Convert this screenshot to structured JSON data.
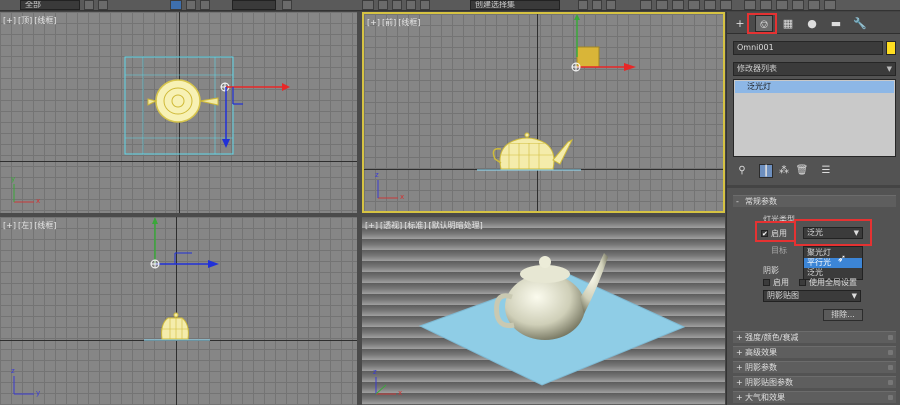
{
  "toolbar": {
    "selection_filter": "全部",
    "named_set": "创建选择集"
  },
  "viewports": {
    "top": {
      "label": [
        "[+]",
        "[顶]",
        "[线框]"
      ]
    },
    "front": {
      "label": [
        "[+]",
        "[前]",
        "[线框]"
      ]
    },
    "left": {
      "label": [
        "[+]",
        "[左]",
        "[线框]"
      ]
    },
    "perspective": {
      "label": [
        "[+]",
        "[透视]",
        "[标准]",
        "[默认明暗处理]"
      ]
    },
    "axis": {
      "x": "x",
      "y": "y",
      "z": "z"
    }
  },
  "panel": {
    "tabs": [
      "+",
      "⎊",
      "▦",
      "●",
      "▬",
      "🔧"
    ],
    "object_name": "Omni001",
    "object_color": "#ffde21",
    "modifier_list": "修改器列表",
    "stack_item": "泛光灯",
    "general": {
      "title": "常规参数",
      "light_type_label": "灯光类型",
      "enable_label": "启用",
      "light_type_value": "泛光",
      "dropdown_options": [
        "聚光灯",
        "平行光",
        "泛光"
      ],
      "target_label": "目标",
      "shadows_label": "阴影",
      "shadows_enable": "启用",
      "global_settings": "使用全局设置",
      "shadow_type": "阴影贴图",
      "exclude_button": "排除..."
    },
    "rollouts": [
      "强度/颜色/衰减",
      "高级效果",
      "阴影参数",
      "阴影贴图参数",
      "大气和效果"
    ]
  }
}
